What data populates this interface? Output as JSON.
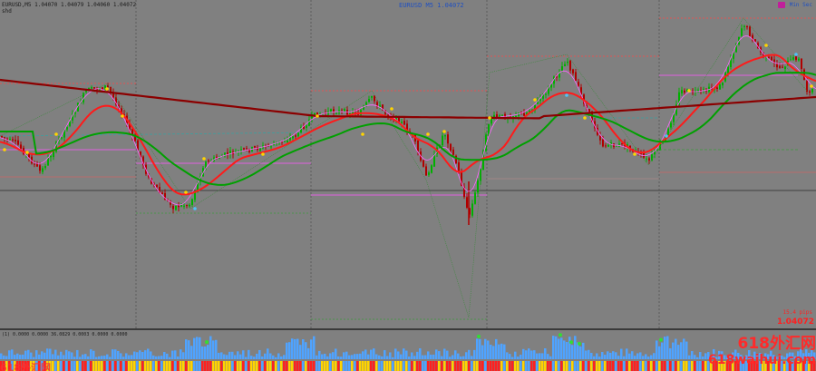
{
  "header": {
    "symbol_info": "EURUSD,M5 1.04070 1.04079 1.04060 1.04072",
    "sub_info": "shd",
    "center_title": "EURUSD    M5    1.04072",
    "top_right": "Min  Sec"
  },
  "readouts": {
    "pips": "15.4 pips",
    "price": "1.04072"
  },
  "indicator": {
    "info": "(1) 0.0000 0.0000 36.0829 0.0003 0.0000 0.0000"
  },
  "watermark": {
    "line1": "618外汇网",
    "line2": "618waihui.com",
    "bottom_left": "618外汇网"
  },
  "colors": {
    "background": "#808080",
    "bull_candle": "#00b000",
    "bear_candle": "#b00000",
    "ema_red": "#ff1a1a",
    "sma_green": "#00b000",
    "sma_darkred": "#8b0000",
    "magenta": "#ff55ff",
    "histogram_blue": "#4fa3ff",
    "histogram_yellow": "#ffd400",
    "watermark_red": "#ff2a2a"
  }
}
